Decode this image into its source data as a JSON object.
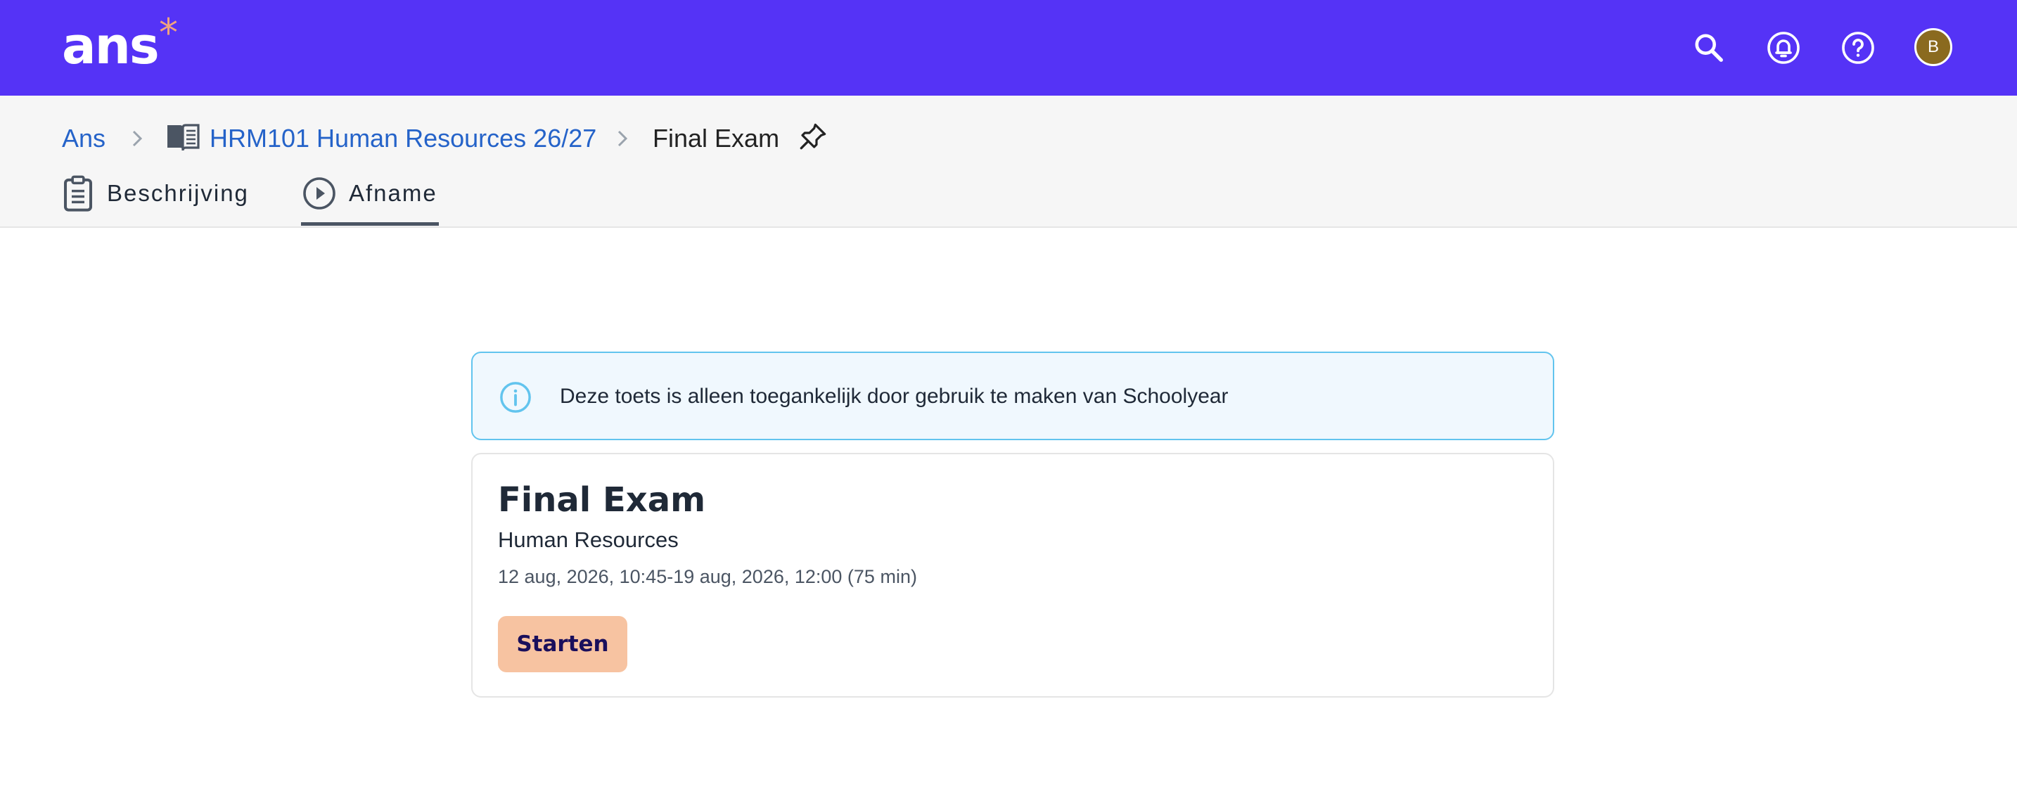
{
  "app": {
    "logo_text": "ans",
    "logo_mark": "*",
    "avatar_initial": "B",
    "icons": [
      "search-icon",
      "bell-icon",
      "help-icon"
    ]
  },
  "breadcrumb": {
    "root": "Ans",
    "course": "HRM101 Human Resources 26/27",
    "current": "Final Exam"
  },
  "tabs": [
    {
      "label": "Beschrijving",
      "icon": "clipboard-icon",
      "active": false
    },
    {
      "label": "Afname",
      "icon": "play-circle-icon",
      "active": true
    }
  ],
  "alert": {
    "icon": "info-icon",
    "text": "Deze toets is alleen toegankelijk door gebruik te maken van Schoolyear"
  },
  "exam": {
    "title": "Final Exam",
    "subtitle": "Human Resources",
    "dates": "12 aug, 2026, 10:45-19 aug, 2026, 12:00 (75 min)",
    "start_label": "Starten"
  },
  "colors": {
    "brand": "#5533f6",
    "link": "#2563c9",
    "alert_border": "#62c4ee",
    "alert_bg": "#f0f8fe",
    "button_bg": "#f7c3a1",
    "logo_mark": "#f0a37e"
  }
}
